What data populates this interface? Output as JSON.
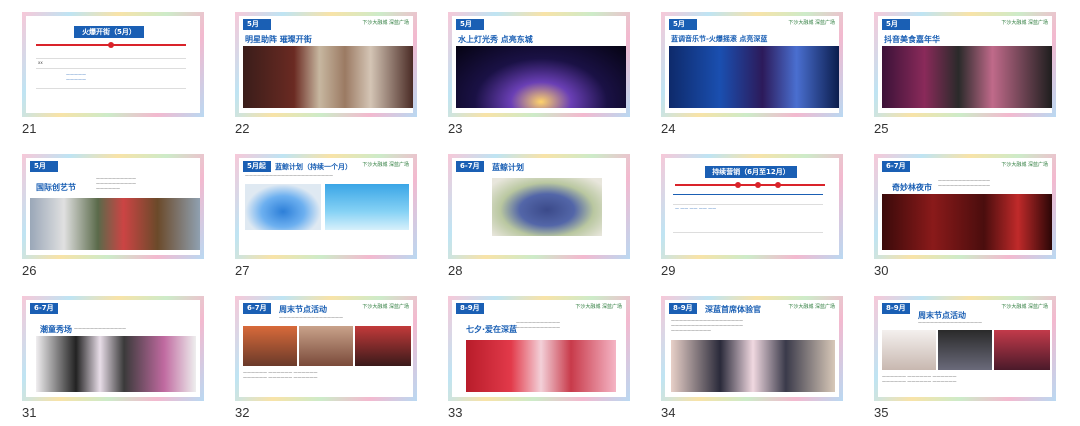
{
  "slides": [
    {
      "num": "21",
      "title": "火爆开街（5月）"
    },
    {
      "num": "22",
      "tag": "5月",
      "title": "明星助阵  璀璨开街",
      "logo": "下沙大融城  深蓝广场"
    },
    {
      "num": "23",
      "tag": "5月",
      "title": "水上灯光秀  点亮东城"
    },
    {
      "num": "24",
      "tag": "5月",
      "title": "蓝调音乐节-火爆摇滚  点亮深蓝",
      "logo": "下沙大融城  深蓝广场"
    },
    {
      "num": "25",
      "tag": "5月",
      "title": "抖音美食嘉年华",
      "logo": "下沙大融城  深蓝广场"
    },
    {
      "num": "26",
      "tag": "5月",
      "title": "国际创艺节"
    },
    {
      "num": "27",
      "tag": "5月起",
      "title": "蓝鲸计划（持续一个月）",
      "logo": "下沙大融城  深蓝广场"
    },
    {
      "num": "28",
      "tag": "6-7月",
      "title": "蓝鲸计划"
    },
    {
      "num": "29",
      "title": "持续营销（6月至12月）"
    },
    {
      "num": "30",
      "tag": "6-7月",
      "title": "奇妙林夜市",
      "logo": "下沙大融城  深蓝广场"
    },
    {
      "num": "31",
      "tag": "6-7月",
      "title": "潮童秀场"
    },
    {
      "num": "32",
      "tag": "6-7月",
      "title": "周末节点活动",
      "logo": "下沙大融城  深蓝广场"
    },
    {
      "num": "33",
      "tag": "8-9月",
      "title": "七夕·爱在深蓝",
      "logo": "下沙大融城  深蓝广场"
    },
    {
      "num": "34",
      "tag": "8-9月",
      "title": "深蓝首席体验官",
      "logo": "下沙大融城  深蓝广场"
    },
    {
      "num": "35",
      "tag": "8-9月",
      "title": "周末节点活动",
      "logo": "下沙大融城  深蓝广场"
    }
  ],
  "colors": {
    "accent": "#1a5fb4",
    "red": "#d9232a"
  }
}
